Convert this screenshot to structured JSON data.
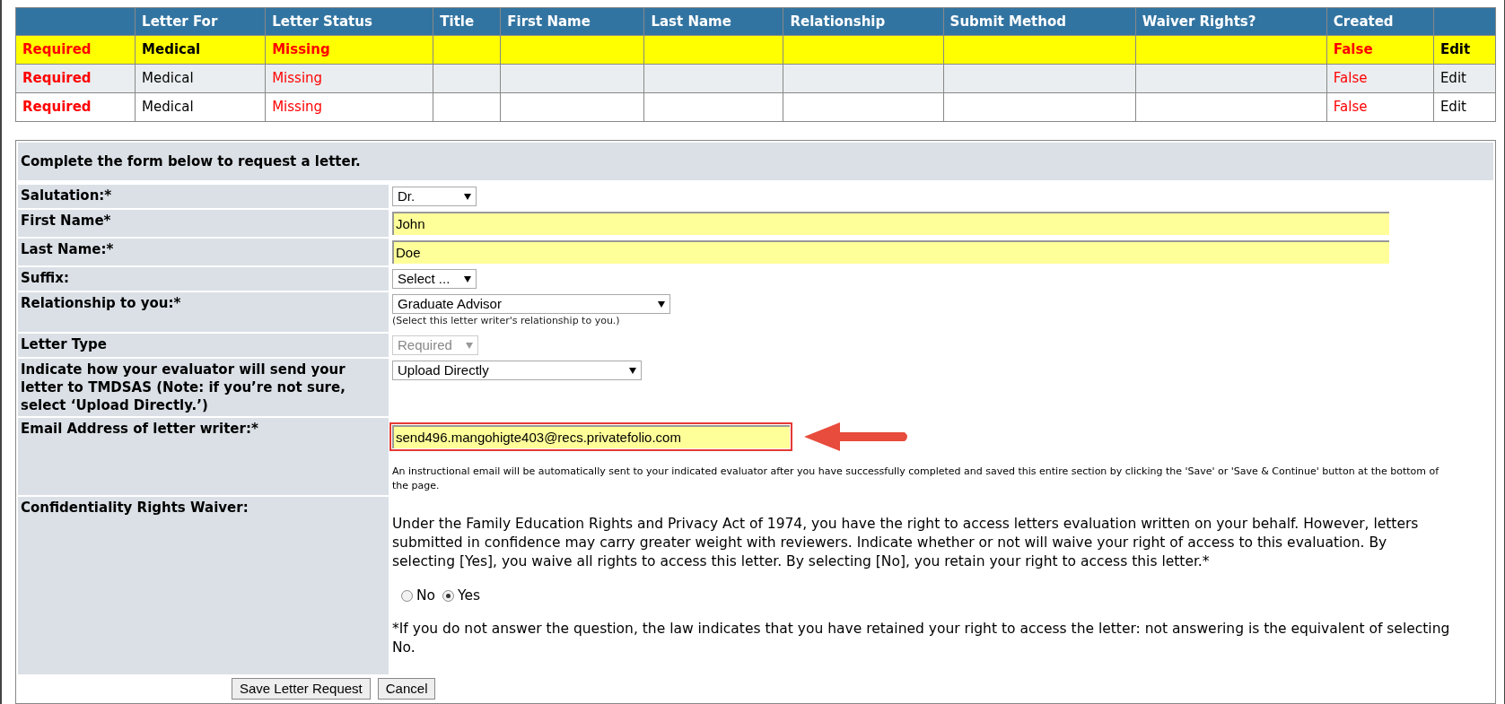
{
  "letters_table": {
    "columns": [
      "",
      "Letter For",
      "Letter Status",
      "Title",
      "First Name",
      "Last Name",
      "Relationship",
      "Submit Method",
      "Waiver Rights?",
      "Created",
      ""
    ],
    "rows": [
      {
        "selected": true,
        "cells": [
          "Required",
          "Medical",
          "Missing",
          "",
          "",
          "",
          "",
          "",
          "",
          "False",
          "Edit"
        ]
      },
      {
        "selected": false,
        "cells": [
          "Required",
          "Medical",
          "Missing",
          "",
          "",
          "",
          "",
          "",
          "",
          "False",
          "Edit"
        ]
      },
      {
        "selected": false,
        "cells": [
          "Required",
          "Medical",
          "Missing",
          "",
          "",
          "",
          "",
          "",
          "",
          "False",
          "Edit"
        ]
      }
    ]
  },
  "form": {
    "heading": "Complete the form below to request a letter.",
    "fields": [
      {
        "label": "Salutation:*",
        "kind": "select",
        "value": "Dr.",
        "disabled": false
      },
      {
        "label": "First Name*",
        "kind": "text",
        "value": "John"
      },
      {
        "label": "Last Name:*",
        "kind": "text",
        "value": "Doe"
      },
      {
        "label": "Suffix:",
        "kind": "select",
        "value": "Select ...",
        "disabled": false
      },
      {
        "label": "Relationship to you:*",
        "kind": "select",
        "value": "Graduate Advisor",
        "disabled": false,
        "hint": "(Select this letter writer's relationship to you.)"
      },
      {
        "label": "Letter Type",
        "kind": "select",
        "value": "Required",
        "disabled": true
      },
      {
        "label": "Indicate how your evaluator will send your letter to TMDSAS (Note: if you’re not sure, select ‘Upload Directly.’)",
        "kind": "select",
        "value": "Upload Directly",
        "disabled": false
      },
      {
        "label": "Email Address of letter writer:*",
        "kind": "text",
        "value": "send496.mangohigte403@recs.privatefolio.com",
        "highlighted": true,
        "note": "An instructional email will be automatically sent to your indicated evaluator after you have successfully completed and saved this entire section by clicking the 'Save' or 'Save & Continue' button at the bottom of the page."
      },
      {
        "label": "Confidentiality Rights Waiver:",
        "kind": "radio",
        "intro": "Under the Family Education Rights and Privacy Act of 1974, you have the right to access letters evaluation written on your behalf. However, letters submitted in confidence may carry greater weight with reviewers. Indicate whether or not will waive your right of access to this evaluation. By selecting [Yes], you waive all rights to access this letter. By selecting [No], you retain your right to access this letter.*",
        "options": [
          {
            "label": "No",
            "selected": false
          },
          {
            "label": "Yes",
            "selected": true
          }
        ],
        "footnote": "*If you do not answer the question, the law indicates that you have retained your right to access the letter: not answering is the equivalent of selecting No."
      }
    ],
    "buttons": [
      "Save Letter Request",
      "Cancel"
    ]
  }
}
